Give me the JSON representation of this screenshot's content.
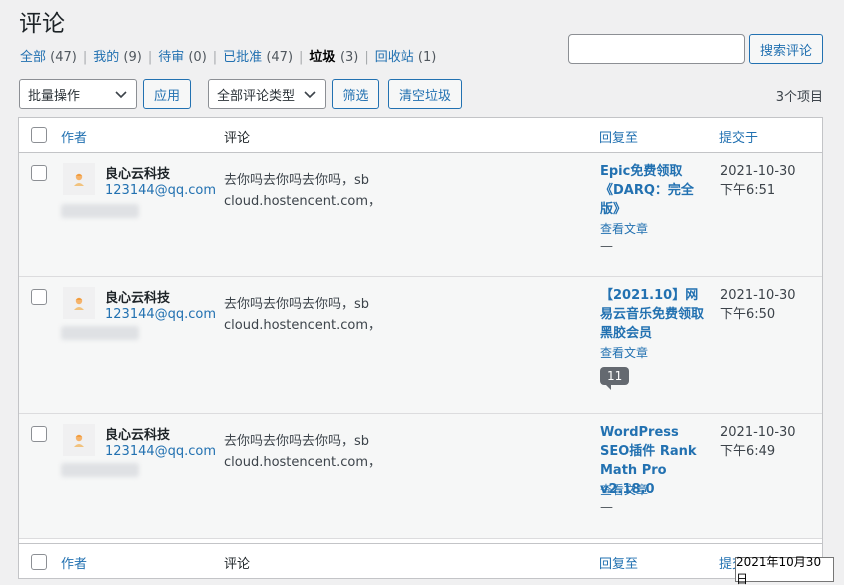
{
  "page": {
    "title": "评论"
  },
  "filters": [
    {
      "label": "全部",
      "count": "(47)",
      "current": false
    },
    {
      "label": "我的",
      "count": "(9)",
      "current": false
    },
    {
      "label": "待审",
      "count": "(0)",
      "current": false
    },
    {
      "label": "已批准",
      "count": "(47)",
      "current": false
    },
    {
      "label": "垃圾",
      "count": "(3)",
      "current": true
    },
    {
      "label": "回收站",
      "count": "(1)",
      "current": false
    }
  ],
  "search": {
    "button": "搜索评论",
    "placeholder": ""
  },
  "toolbar": {
    "bulk_select": "批量操作",
    "apply": "应用",
    "type_select": "全部评论类型",
    "filter": "筛选",
    "empty_spam": "清空垃圾",
    "items_count": "3个项目"
  },
  "table": {
    "headers": {
      "author": "作者",
      "comment": "评论",
      "response": "回复至",
      "date": "提交于"
    },
    "rows": [
      {
        "author": "良心云科技",
        "email": "123144@qq.com",
        "comment": "去你吗去你吗去你吗，sb cloud.hostencent.com，",
        "response_title": "Epic免费领取《DARQ：完全版》",
        "view_post": "查看文章",
        "dash": "—",
        "date": "2021-10-30 下午6:51"
      },
      {
        "author": "良心云科技",
        "email": "123144@qq.com",
        "comment": "去你吗去你吗去你吗，sb cloud.hostencent.com，",
        "response_title": "【2021.10】网易云音乐免费领取黑胶会员",
        "view_post": "查看文章",
        "bubble": "11",
        "date": "2021-10-30 下午6:50"
      },
      {
        "author": "良心云科技",
        "email": "123144@qq.com",
        "comment": "去你吗去你吗去你吗，sb cloud.hostencent.com，",
        "response_title": "WordPress SEO插件 Rank Math Pro v2.18.0",
        "view_post": "查看文章",
        "dash": "—",
        "date": "2021-10-30 下午6:49"
      }
    ]
  },
  "tooltip": "2021年10月30日"
}
